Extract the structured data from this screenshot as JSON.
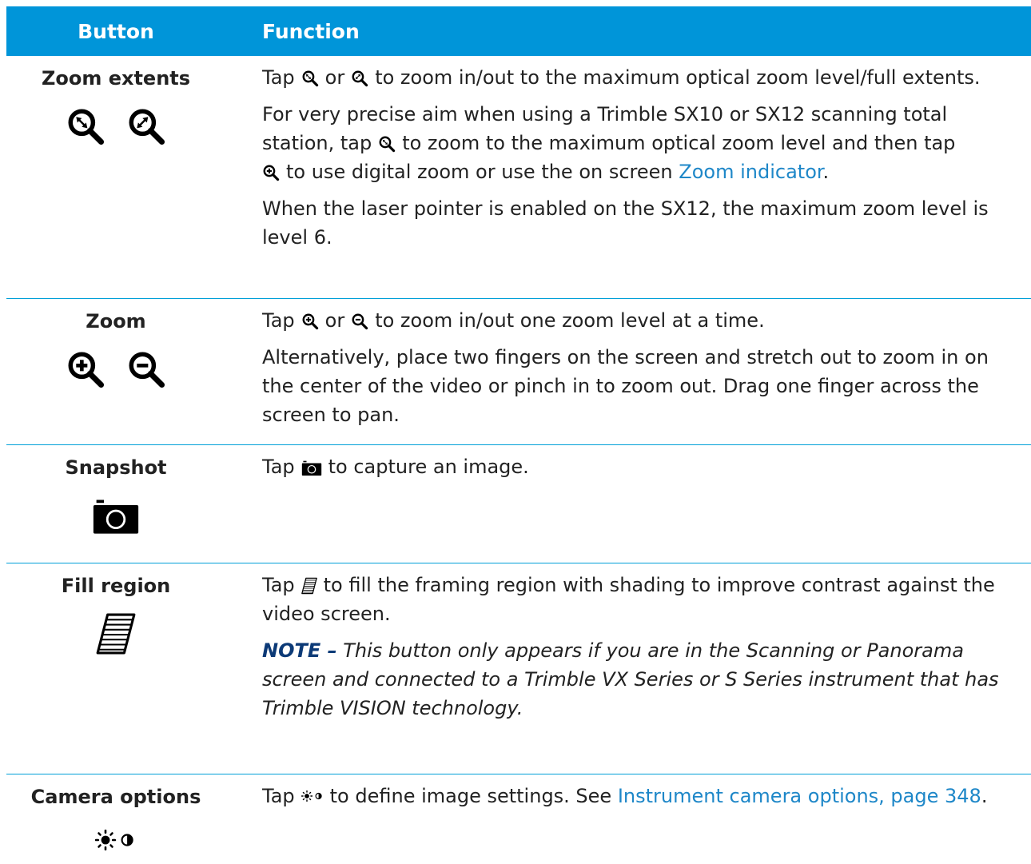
{
  "header": {
    "button": "Button",
    "function": "Function"
  },
  "rows": {
    "zoom_extents": {
      "name": "Zoom extents",
      "icons": [
        "zoom-to-max-optical-icon",
        "zoom-full-extents-icon"
      ],
      "p1": {
        "a": "Tap",
        "b": "or",
        "c": "to zoom in/out to the maximum optical zoom level/full extents."
      },
      "p2": {
        "a": "For very precise aim when using a Trimble SX10 or SX12 scanning total station, tap",
        "b": "to zoom to the maximum optical zoom level and then tap",
        "c": "to use digital zoom or use the on screen",
        "link": "Zoom indicator",
        "d": "."
      },
      "p3": "When the laser pointer is enabled on the SX12, the maximum zoom level is level 6."
    },
    "zoom": {
      "name": "Zoom",
      "icons": [
        "zoom-in-icon",
        "zoom-out-icon"
      ],
      "p1": {
        "a": "Tap",
        "b": "or",
        "c": "to zoom in/out one zoom level at a time."
      },
      "p2": "Alternatively, place two fingers on the screen and stretch out to zoom in on the center of the video or pinch in to zoom out. Drag one finger across the screen to pan."
    },
    "snapshot": {
      "name": "Snapshot",
      "icons": [
        "camera-icon"
      ],
      "p1": {
        "a": "Tap",
        "b": "to capture an image."
      }
    },
    "fill_region": {
      "name": "Fill region",
      "icons": [
        "fill-region-icon"
      ],
      "p1": {
        "a": "Tap",
        "b": "to fill the framing region with shading to improve contrast against the video screen."
      },
      "note": {
        "label": "NOTE –",
        "text": "This button only appears if you are in the Scanning or Panorama screen and connected to a Trimble VX Series or S Series instrument that has Trimble VISION technology."
      }
    },
    "camera_options": {
      "name": "Camera options",
      "icons": [
        "brightness-contrast-icon"
      ],
      "p1": {
        "a": "Tap",
        "b": "to define image settings. See",
        "link": "Instrument camera options, page 348",
        "c": "."
      }
    }
  },
  "colors": {
    "header_bg": "#0095d9",
    "link": "#1e87c8",
    "note_label": "#0c3a77",
    "rule": "#00a0d8"
  }
}
